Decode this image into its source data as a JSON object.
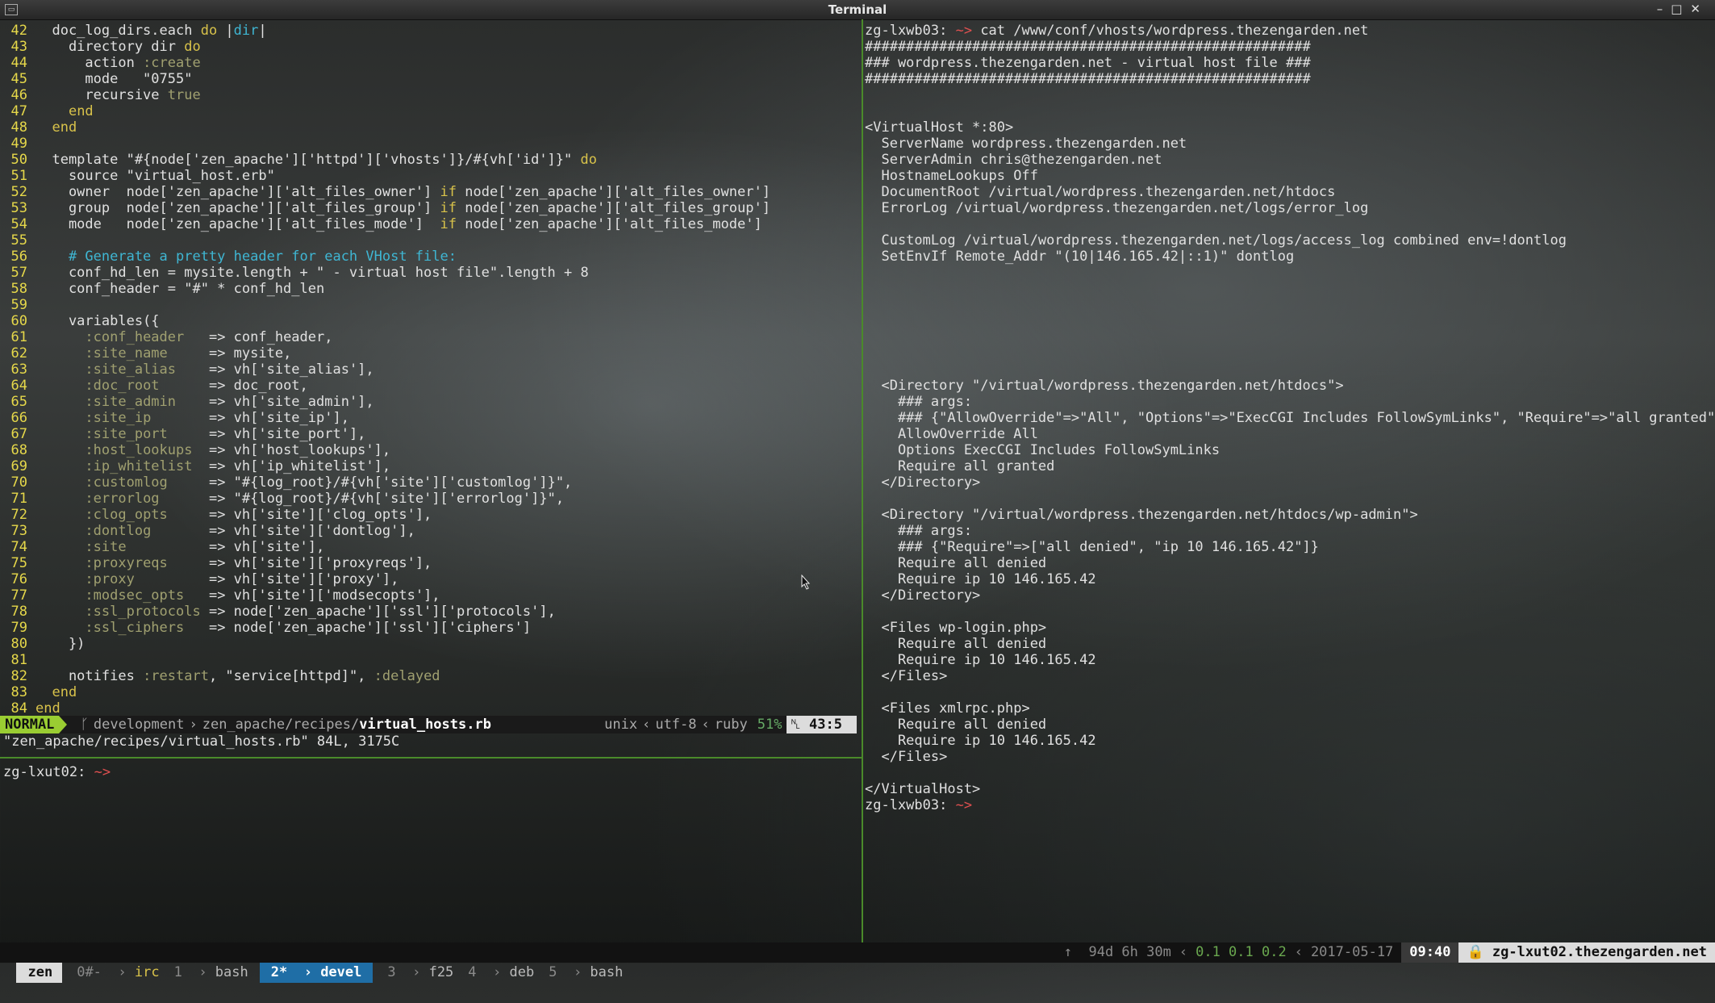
{
  "window": {
    "title": "Terminal",
    "controls": [
      "–",
      "□",
      "✕"
    ]
  },
  "vim": {
    "lines": [
      {
        "n": "42",
        "segs": [
          {
            "t": "  doc_log_dirs.each ",
            "c": "code"
          },
          {
            "t": "do",
            "c": "kw"
          },
          {
            "t": " |",
            "c": "code"
          },
          {
            "t": "dir",
            "c": "cm"
          },
          {
            "t": "|",
            "c": "code"
          }
        ]
      },
      {
        "n": "43",
        "segs": [
          {
            "t": "    directory dir ",
            "c": "code"
          },
          {
            "t": "do",
            "c": "kw"
          }
        ]
      },
      {
        "n": "44",
        "segs": [
          {
            "t": "      action ",
            "c": "code"
          },
          {
            "t": ":create",
            "c": "sym"
          }
        ]
      },
      {
        "n": "45",
        "segs": [
          {
            "t": "      mode   \"0755\"",
            "c": "code"
          }
        ]
      },
      {
        "n": "46",
        "segs": [
          {
            "t": "      recursive ",
            "c": "code"
          },
          {
            "t": "true",
            "c": "sym"
          }
        ]
      },
      {
        "n": "47",
        "segs": [
          {
            "t": "    ",
            "c": "code"
          },
          {
            "t": "end",
            "c": "kw"
          }
        ]
      },
      {
        "n": "48",
        "segs": [
          {
            "t": "  ",
            "c": "code"
          },
          {
            "t": "end",
            "c": "kw"
          }
        ]
      },
      {
        "n": "49",
        "segs": []
      },
      {
        "n": "50",
        "segs": [
          {
            "t": "  template \"#{node['zen_apache']['httpd']['vhosts']}/#{vh['id']}\" ",
            "c": "code"
          },
          {
            "t": "do",
            "c": "kw"
          }
        ]
      },
      {
        "n": "51",
        "segs": [
          {
            "t": "    source \"virtual_host.erb\"",
            "c": "code"
          }
        ]
      },
      {
        "n": "52",
        "segs": [
          {
            "t": "    owner  node['zen_apache']['alt_files_owner'] ",
            "c": "code"
          },
          {
            "t": "if",
            "c": "kw"
          },
          {
            "t": " node['zen_apache']['alt_files_owner']",
            "c": "code"
          }
        ]
      },
      {
        "n": "53",
        "segs": [
          {
            "t": "    group  node['zen_apache']['alt_files_group'] ",
            "c": "code"
          },
          {
            "t": "if",
            "c": "kw"
          },
          {
            "t": " node['zen_apache']['alt_files_group']",
            "c": "code"
          }
        ]
      },
      {
        "n": "54",
        "segs": [
          {
            "t": "    mode   node['zen_apache']['alt_files_mode']  ",
            "c": "code"
          },
          {
            "t": "if",
            "c": "kw"
          },
          {
            "t": " node['zen_apache']['alt_files_mode']",
            "c": "code"
          }
        ]
      },
      {
        "n": "55",
        "segs": []
      },
      {
        "n": "56",
        "segs": [
          {
            "t": "    # Generate a pretty header for each VHost file:",
            "c": "cm"
          }
        ]
      },
      {
        "n": "57",
        "segs": [
          {
            "t": "    conf_hd_len = mysite.length + \" - virtual host file\".length + 8",
            "c": "code"
          }
        ]
      },
      {
        "n": "58",
        "segs": [
          {
            "t": "    conf_header = \"#\" * conf_hd_len",
            "c": "code"
          }
        ]
      },
      {
        "n": "59",
        "segs": []
      },
      {
        "n": "60",
        "segs": [
          {
            "t": "    variables({",
            "c": "code"
          }
        ]
      },
      {
        "n": "61",
        "segs": [
          {
            "t": "      ",
            "c": "code"
          },
          {
            "t": ":conf_header",
            "c": "sym"
          },
          {
            "t": "   => conf_header,",
            "c": "code"
          }
        ]
      },
      {
        "n": "62",
        "segs": [
          {
            "t": "      ",
            "c": "code"
          },
          {
            "t": ":site_name",
            "c": "sym"
          },
          {
            "t": "     => mysite,",
            "c": "code"
          }
        ]
      },
      {
        "n": "63",
        "segs": [
          {
            "t": "      ",
            "c": "code"
          },
          {
            "t": ":site_alias",
            "c": "sym"
          },
          {
            "t": "    => vh['site_alias'],",
            "c": "code"
          }
        ]
      },
      {
        "n": "64",
        "segs": [
          {
            "t": "      ",
            "c": "code"
          },
          {
            "t": ":doc_root",
            "c": "sym"
          },
          {
            "t": "      => doc_root,",
            "c": "code"
          }
        ]
      },
      {
        "n": "65",
        "segs": [
          {
            "t": "      ",
            "c": "code"
          },
          {
            "t": ":site_admin",
            "c": "sym"
          },
          {
            "t": "    => vh['site_admin'],",
            "c": "code"
          }
        ]
      },
      {
        "n": "66",
        "segs": [
          {
            "t": "      ",
            "c": "code"
          },
          {
            "t": ":site_ip",
            "c": "sym"
          },
          {
            "t": "       => vh['site_ip'],",
            "c": "code"
          }
        ]
      },
      {
        "n": "67",
        "segs": [
          {
            "t": "      ",
            "c": "code"
          },
          {
            "t": ":site_port",
            "c": "sym"
          },
          {
            "t": "     => vh['site_port'],",
            "c": "code"
          }
        ]
      },
      {
        "n": "68",
        "segs": [
          {
            "t": "      ",
            "c": "code"
          },
          {
            "t": ":host_lookups",
            "c": "sym"
          },
          {
            "t": "  => vh['host_lookups'],",
            "c": "code"
          }
        ]
      },
      {
        "n": "69",
        "segs": [
          {
            "t": "      ",
            "c": "code"
          },
          {
            "t": ":ip_whitelist",
            "c": "sym"
          },
          {
            "t": "  => vh['ip_whitelist'],",
            "c": "code"
          }
        ]
      },
      {
        "n": "70",
        "segs": [
          {
            "t": "      ",
            "c": "code"
          },
          {
            "t": ":customlog",
            "c": "sym"
          },
          {
            "t": "     => \"#{log_root}/#{vh['site']['customlog']}\",",
            "c": "code"
          }
        ]
      },
      {
        "n": "71",
        "segs": [
          {
            "t": "      ",
            "c": "code"
          },
          {
            "t": ":errorlog",
            "c": "sym"
          },
          {
            "t": "      => \"#{log_root}/#{vh['site']['errorlog']}\",",
            "c": "code"
          }
        ]
      },
      {
        "n": "72",
        "segs": [
          {
            "t": "      ",
            "c": "code"
          },
          {
            "t": ":clog_opts",
            "c": "sym"
          },
          {
            "t": "     => vh['site']['clog_opts'],",
            "c": "code"
          }
        ]
      },
      {
        "n": "73",
        "segs": [
          {
            "t": "      ",
            "c": "code"
          },
          {
            "t": ":dontlog",
            "c": "sym"
          },
          {
            "t": "       => vh['site']['dontlog'],",
            "c": "code"
          }
        ]
      },
      {
        "n": "74",
        "segs": [
          {
            "t": "      ",
            "c": "code"
          },
          {
            "t": ":site",
            "c": "sym"
          },
          {
            "t": "          => vh['site'],",
            "c": "code"
          }
        ]
      },
      {
        "n": "75",
        "segs": [
          {
            "t": "      ",
            "c": "code"
          },
          {
            "t": ":proxyreqs",
            "c": "sym"
          },
          {
            "t": "     => vh['site']['proxyreqs'],",
            "c": "code"
          }
        ]
      },
      {
        "n": "76",
        "segs": [
          {
            "t": "      ",
            "c": "code"
          },
          {
            "t": ":proxy",
            "c": "sym"
          },
          {
            "t": "         => vh['site']['proxy'],",
            "c": "code"
          }
        ]
      },
      {
        "n": "77",
        "segs": [
          {
            "t": "      ",
            "c": "code"
          },
          {
            "t": ":modsec_opts",
            "c": "sym"
          },
          {
            "t": "   => vh['site']['modsecopts'],",
            "c": "code"
          }
        ]
      },
      {
        "n": "78",
        "segs": [
          {
            "t": "      ",
            "c": "code"
          },
          {
            "t": ":ssl_protocols",
            "c": "sym"
          },
          {
            "t": " => node['zen_apache']['ssl']['protocols'],",
            "c": "code"
          }
        ]
      },
      {
        "n": "79",
        "segs": [
          {
            "t": "      ",
            "c": "code"
          },
          {
            "t": ":ssl_ciphers",
            "c": "sym"
          },
          {
            "t": "   => node['zen_apache']['ssl']['ciphers']",
            "c": "code"
          }
        ]
      },
      {
        "n": "80",
        "segs": [
          {
            "t": "    })",
            "c": "code"
          }
        ]
      },
      {
        "n": "81",
        "segs": []
      },
      {
        "n": "82",
        "segs": [
          {
            "t": "    notifies ",
            "c": "code"
          },
          {
            "t": ":restart",
            "c": "sym"
          },
          {
            "t": ", \"service[httpd]\", ",
            "c": "code"
          },
          {
            "t": ":delayed",
            "c": "sym"
          }
        ]
      },
      {
        "n": "83",
        "segs": [
          {
            "t": "  ",
            "c": "code"
          },
          {
            "t": "end",
            "c": "kw"
          }
        ]
      },
      {
        "n": "84",
        "segs": [
          {
            "t": "end",
            "c": "kw"
          }
        ]
      }
    ],
    "statusline": {
      "mode": "NORMAL",
      "branch_icon": "ᚴ",
      "branch": "development",
      "path": "zen_apache/recipes/",
      "file": "virtual_hosts.rb",
      "fileformat": "unix",
      "encoding": "utf-8",
      "filetype": "ruby",
      "percent": "51%",
      "line_icon": "␤",
      "position": "43:5"
    },
    "message": "\"zen_apache/recipes/virtual_hosts.rb\" 84L, 3175C"
  },
  "bottom_left": {
    "host": "zg-lxut02:",
    "tilde": " ~>"
  },
  "right": {
    "lines": [
      {
        "segs": [
          {
            "t": "zg-lxwb03:",
            "c": "prompt-host"
          },
          {
            "t": " ~> ",
            "c": "prompt-tilde"
          },
          {
            "t": "cat /www/conf/vhosts/wordpress.thezengarden.net",
            "c": "code"
          }
        ]
      },
      {
        "segs": [
          {
            "t": "######################################################",
            "c": "code"
          }
        ]
      },
      {
        "segs": [
          {
            "t": "### wordpress.thezengarden.net - virtual host file ###",
            "c": "code"
          }
        ]
      },
      {
        "segs": [
          {
            "t": "######################################################",
            "c": "code"
          }
        ]
      },
      {
        "segs": []
      },
      {
        "segs": []
      },
      {
        "segs": [
          {
            "t": "<VirtualHost *:80>",
            "c": "code"
          }
        ]
      },
      {
        "segs": [
          {
            "t": "  ServerName wordpress.thezengarden.net",
            "c": "code"
          }
        ]
      },
      {
        "segs": [
          {
            "t": "  ServerAdmin chris@thezengarden.net",
            "c": "code"
          }
        ]
      },
      {
        "segs": [
          {
            "t": "  HostnameLookups Off",
            "c": "code"
          }
        ]
      },
      {
        "segs": [
          {
            "t": "  DocumentRoot /virtual/wordpress.thezengarden.net/htdocs",
            "c": "code"
          }
        ]
      },
      {
        "segs": [
          {
            "t": "  ErrorLog /virtual/wordpress.thezengarden.net/logs/error_log",
            "c": "code"
          }
        ]
      },
      {
        "segs": []
      },
      {
        "segs": [
          {
            "t": "  CustomLog /virtual/wordpress.thezengarden.net/logs/access_log combined env=!dontlog",
            "c": "code"
          }
        ]
      },
      {
        "segs": [
          {
            "t": "  SetEnvIf Remote_Addr \"(10|146.165.42|::1)\" dontlog",
            "c": "code"
          }
        ]
      },
      {
        "segs": []
      },
      {
        "segs": []
      },
      {
        "segs": []
      },
      {
        "segs": []
      },
      {
        "segs": []
      },
      {
        "segs": []
      },
      {
        "segs": []
      },
      {
        "segs": [
          {
            "t": "  <Directory \"/virtual/wordpress.thezengarden.net/htdocs\">",
            "c": "code"
          }
        ]
      },
      {
        "segs": [
          {
            "t": "    ### args:",
            "c": "code"
          }
        ]
      },
      {
        "segs": [
          {
            "t": "    ### {\"AllowOverride\"=>\"All\", \"Options\"=>\"ExecCGI Includes FollowSymLinks\", \"Require\"=>\"all granted\"}",
            "c": "code"
          }
        ]
      },
      {
        "segs": [
          {
            "t": "    AllowOverride All",
            "c": "code"
          }
        ]
      },
      {
        "segs": [
          {
            "t": "    Options ExecCGI Includes FollowSymLinks",
            "c": "code"
          }
        ]
      },
      {
        "segs": [
          {
            "t": "    Require all granted",
            "c": "code"
          }
        ]
      },
      {
        "segs": [
          {
            "t": "  </Directory>",
            "c": "code"
          }
        ]
      },
      {
        "segs": []
      },
      {
        "segs": [
          {
            "t": "  <Directory \"/virtual/wordpress.thezengarden.net/htdocs/wp-admin\">",
            "c": "code"
          }
        ]
      },
      {
        "segs": [
          {
            "t": "    ### args:",
            "c": "code"
          }
        ]
      },
      {
        "segs": [
          {
            "t": "    ### {\"Require\"=>[\"all denied\", \"ip 10 146.165.42\"]}",
            "c": "code"
          }
        ]
      },
      {
        "segs": [
          {
            "t": "    Require all denied",
            "c": "code"
          }
        ]
      },
      {
        "segs": [
          {
            "t": "    Require ip 10 146.165.42",
            "c": "code"
          }
        ]
      },
      {
        "segs": [
          {
            "t": "  </Directory>",
            "c": "code"
          }
        ]
      },
      {
        "segs": []
      },
      {
        "segs": [
          {
            "t": "  <Files wp-login.php>",
            "c": "code"
          }
        ]
      },
      {
        "segs": [
          {
            "t": "    Require all denied",
            "c": "code"
          }
        ]
      },
      {
        "segs": [
          {
            "t": "    Require ip 10 146.165.42",
            "c": "code"
          }
        ]
      },
      {
        "segs": [
          {
            "t": "  </Files>",
            "c": "code"
          }
        ]
      },
      {
        "segs": []
      },
      {
        "segs": [
          {
            "t": "  <Files xmlrpc.php>",
            "c": "code"
          }
        ]
      },
      {
        "segs": [
          {
            "t": "    Require all denied",
            "c": "code"
          }
        ]
      },
      {
        "segs": [
          {
            "t": "    Require ip 10 146.165.42",
            "c": "code"
          }
        ]
      },
      {
        "segs": [
          {
            "t": "  </Files>",
            "c": "code"
          }
        ]
      },
      {
        "segs": []
      },
      {
        "segs": [
          {
            "t": "</VirtualHost>",
            "c": "code"
          }
        ]
      },
      {
        "segs": [
          {
            "t": "zg-lxwb03:",
            "c": "prompt-host"
          },
          {
            "t": " ~>",
            "c": "prompt-tilde"
          }
        ]
      }
    ]
  },
  "tmux": {
    "session": "zen",
    "windows": [
      {
        "num": "0#-",
        "name": "irc",
        "color": "y"
      },
      {
        "num": "1",
        "name": "bash",
        "color": ""
      }
    ],
    "active": {
      "num": "2*",
      "name": "devel"
    },
    "windows_after": [
      {
        "num": "3",
        "name": "f25",
        "color": ""
      },
      {
        "num": "4",
        "name": "deb",
        "color": ""
      },
      {
        "num": "5",
        "name": "bash",
        "color": ""
      }
    ],
    "uptime": "↑  94d 6h 30m",
    "load": "0.1 0.1 0.2",
    "date": "2017-05-17",
    "time": "09:40",
    "host": "🔒 zg-lxut02.thezengarden.net"
  },
  "colors": {
    "vim_mode_bg": "#9acd32",
    "tmux_active_bg": "#1f6ea6",
    "split_color": "#4a8a2a",
    "keyword": "#d8c24a",
    "comment": "#3fb6d3"
  }
}
